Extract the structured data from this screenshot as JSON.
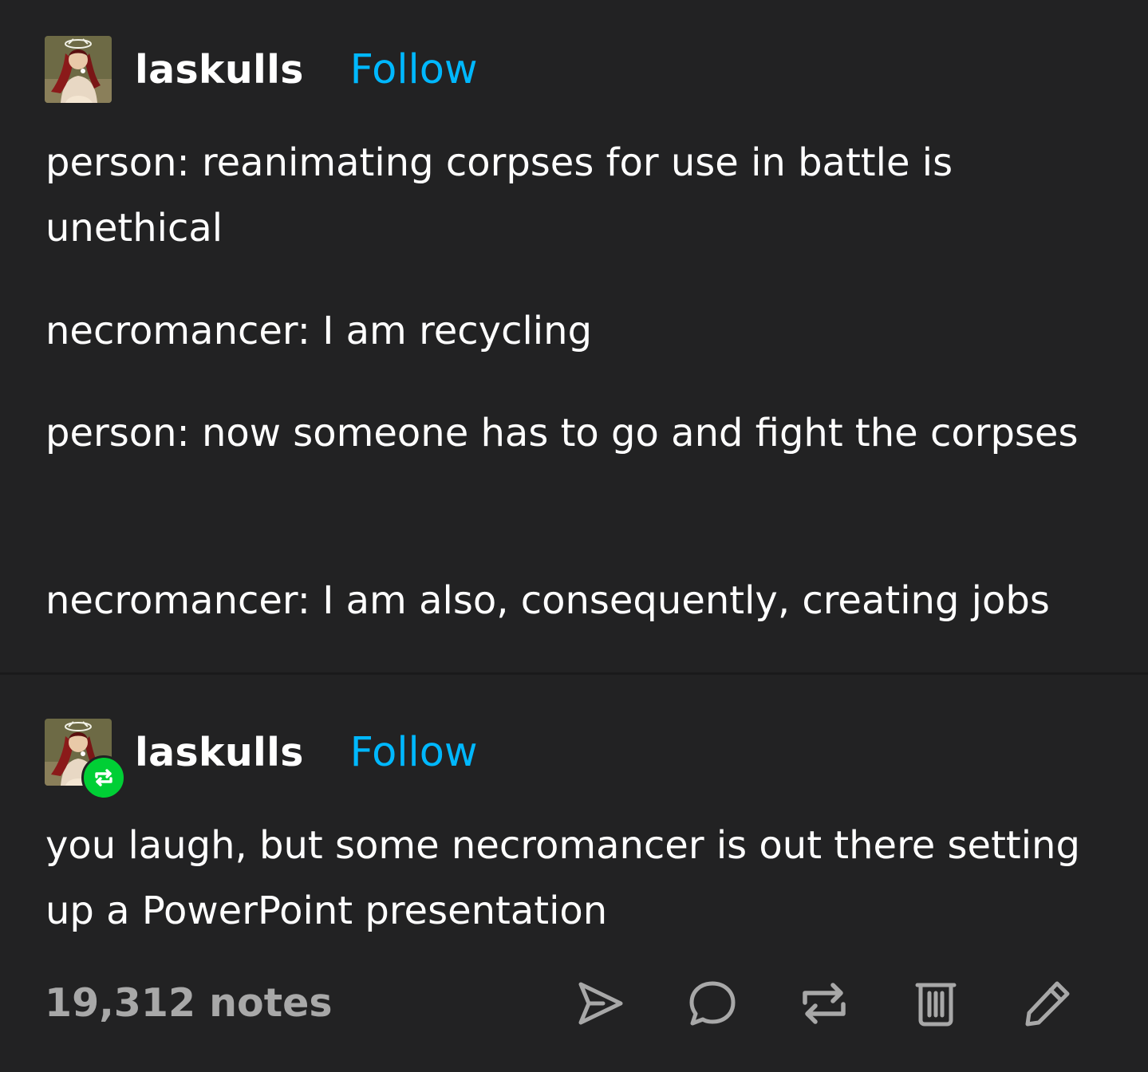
{
  "colors": {
    "background": "#222223",
    "text": "#ffffff",
    "follow": "#00b8ff",
    "notes": "#a8a8a8",
    "reblog_badge": "#00cf35"
  },
  "posts": [
    {
      "username": "laskulls",
      "follow_label": "Follow",
      "reblogged": false,
      "paragraphs": [
        "person: reanimating corpses for use in battle is unethical",
        "necromancer: I am recycling",
        "person: now someone has to go and fight the corpses",
        "necromancer: I am also, consequently, creating jobs"
      ]
    },
    {
      "username": "laskulls",
      "follow_label": "Follow",
      "reblogged": true,
      "paragraphs": [
        "you laugh, but some necromancer is out there setting up a PowerPoint presentation"
      ]
    }
  ],
  "footer": {
    "notes": "19,312 notes",
    "actions": [
      "share-icon",
      "reply-icon",
      "reblog-icon",
      "delete-icon",
      "edit-icon"
    ]
  }
}
